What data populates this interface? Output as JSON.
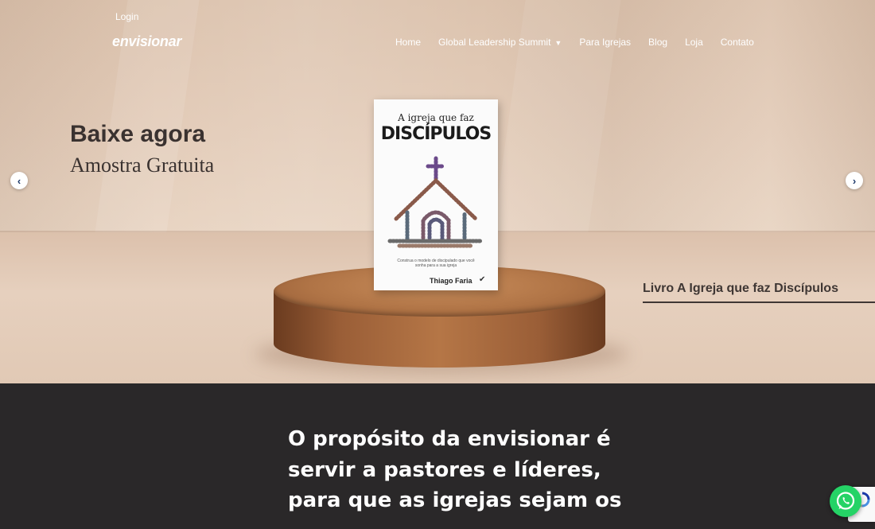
{
  "nav": {
    "login": "Login",
    "logo": "envisionar",
    "items": [
      {
        "label": "Home"
      },
      {
        "label": "Global Leadership Summit"
      },
      {
        "label": "Para Igrejas"
      },
      {
        "label": "Blog"
      },
      {
        "label": "Loja"
      },
      {
        "label": "Contato"
      }
    ]
  },
  "hero": {
    "headline": "Baixe agora",
    "subheadline": "Amostra Gratuita",
    "caption": "Livro A Igreja que faz Discípulos",
    "book": {
      "subtitle": "A igreja que faz",
      "title": "DISCÍPULOS",
      "blurb": "Construa o modelo de discipulado que você sonha para a sua igreja",
      "author": "Thiago Faria"
    }
  },
  "purpose": {
    "text": "O propósito da envisionar é servir a pastores e líderes, para que as igrejas sejam os"
  },
  "icons": {
    "prev": "chevron-left-icon",
    "next": "chevron-right-icon",
    "whatsapp": "whatsapp-icon",
    "recaptcha": "recaptcha-icon"
  },
  "colors": {
    "dark_section": "#2a2829",
    "arrow_icon": "#1e3a6b",
    "whatsapp": "#25d366",
    "heading_text": "#3a3230"
  }
}
